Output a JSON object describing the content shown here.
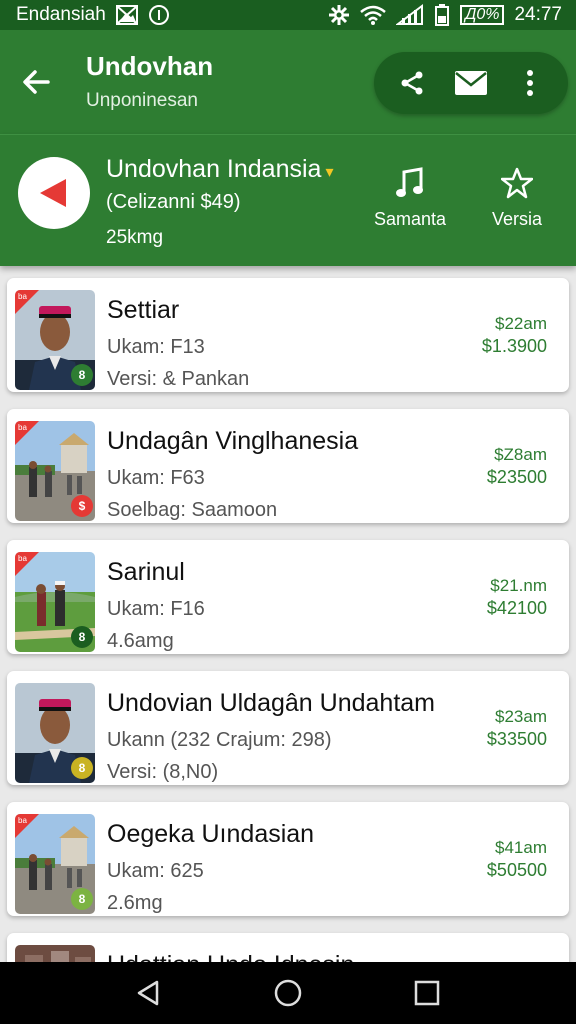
{
  "status_bar": {
    "carrier": "Endansiah",
    "battery_text": "Д0%",
    "time": "24:77",
    "icons": [
      "image-icon",
      "info-circle-icon",
      "settings-gear-icon",
      "wifi-icon",
      "signal-icon",
      "battery-icon"
    ]
  },
  "app_bar": {
    "title": "Undovhan",
    "subtitle": "Unponinesan",
    "icons": [
      "back-arrow-icon",
      "share-icon",
      "mail-icon",
      "more-vert-icon"
    ]
  },
  "header": {
    "title": "Undovhan Indansia",
    "subtitle": "(Celizanni $49)",
    "size": "25kmg",
    "actions": [
      {
        "label": "Samanta",
        "icon": "music-note-icon"
      },
      {
        "label": "Versia",
        "icon": "star-icon"
      }
    ]
  },
  "items": [
    {
      "title": "Settiar",
      "line1": "Ukam: F13",
      "line2": "Versi: & Pankan",
      "time": "$22am",
      "price": "$1.3900",
      "corner": "ba",
      "badge": "8",
      "badge_color": "#2e7d32",
      "thumb": "portrait"
    },
    {
      "title": "Undagân Vinglhanesia",
      "line1": "Ukam: F63",
      "line2": "Soelbag: Saamoon",
      "time": "$Z8am",
      "price": "$23500",
      "corner": "ba",
      "badge": "$",
      "badge_color": "#e53935",
      "thumb": "street"
    },
    {
      "title": "Sarinul",
      "line1": "Ukam: F16",
      "line2": "4.6amg",
      "time": "$21.nm",
      "price": "$42100",
      "corner": "ba",
      "badge": "8",
      "badge_color": "#1b5e20",
      "thumb": "field"
    },
    {
      "title": "Undovian Uldagân Undahtam",
      "line1": "Ukann (232 Crajum: 298)",
      "line2": "Versi: (8,N0)",
      "time": "$23am",
      "price": "$33500",
      "corner": "",
      "badge": "8",
      "badge_color": "#c9b323",
      "thumb": "portrait"
    },
    {
      "title": "Oegeka Uındasian",
      "line1": "Ukam: 625",
      "line2": "2.6mg",
      "time": "$41am",
      "price": "$50500",
      "corner": "ba",
      "badge": "8",
      "badge_color": "#7cb342",
      "thumb": "street"
    },
    {
      "title": "Udattian Undo Idnesin",
      "line1": "",
      "line2": "",
      "time": "",
      "price": "",
      "corner": "",
      "badge": "",
      "badge_color": "#e53935",
      "thumb": "building"
    }
  ],
  "nav_bar": {
    "icons": [
      "nav-back-icon",
      "nav-home-icon",
      "nav-recents-icon"
    ]
  },
  "colors": {
    "primary": "#2e7d32",
    "primary_dark": "#1b5e20",
    "accent_red": "#e53935",
    "price_green": "#2e7d32"
  }
}
